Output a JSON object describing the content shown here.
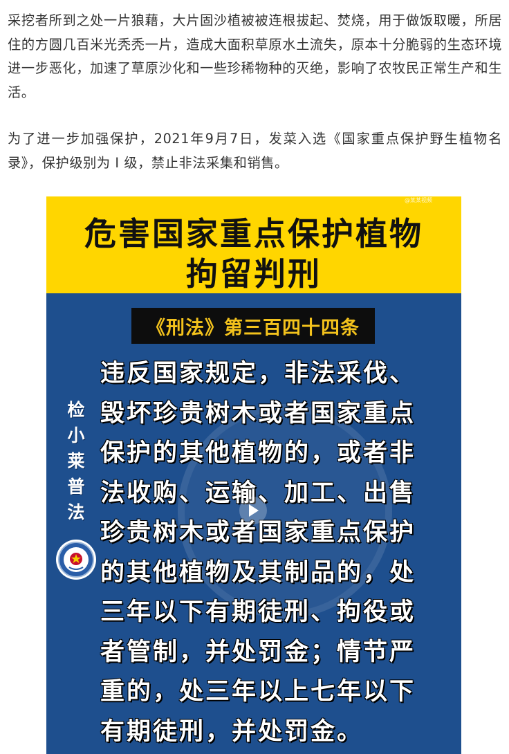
{
  "article": {
    "paragraph1": "采挖者所到之处一片狼藉，大片固沙植被被连根拔起、焚烧，用于做饭取暖，所居住的方圆几百米光秃秃一片，造成大面积草原水土流失，原本十分脆弱的生态环境进一步恶化，加速了草原沙化和一些珍稀物种的灭绝，影响了农牧民正常生产和生活。",
    "paragraph2": "为了进一步加强保护，2021年9月7日，发菜入选《国家重点保护野生植物名录》，保护级别为 I 级，禁止非法采集和销售。"
  },
  "video": {
    "watermark": "@某某视频",
    "banner_line1": "危害国家重点保护植物",
    "banner_line2": "拘留判刑",
    "article_tag": "《刑法》第三百四十四条",
    "vertical_brand": [
      "检",
      "小",
      "莱",
      "普",
      "法"
    ],
    "law_lines": [
      "违反国家规定，非法采伐、",
      "毁坏珍贵树木或者国家重点",
      "保护的其他植物的，或者非",
      "法收购、运输、加工、出售",
      "珍贵树木或者国家重点保护",
      "的其他植物及其制品的，处",
      "三年以下有期徒刑、拘役或",
      "者管制，并处罚金；情节严",
      "重的，处三年以上七年以下",
      "有期徒刑，并处罚金。"
    ],
    "colors": {
      "banner": "#ffd600",
      "background": "#1e4f8e",
      "tag_text": "#f3c21c"
    },
    "icons": {
      "play": "play-icon",
      "seal": "procuratorate-seal-icon"
    }
  }
}
